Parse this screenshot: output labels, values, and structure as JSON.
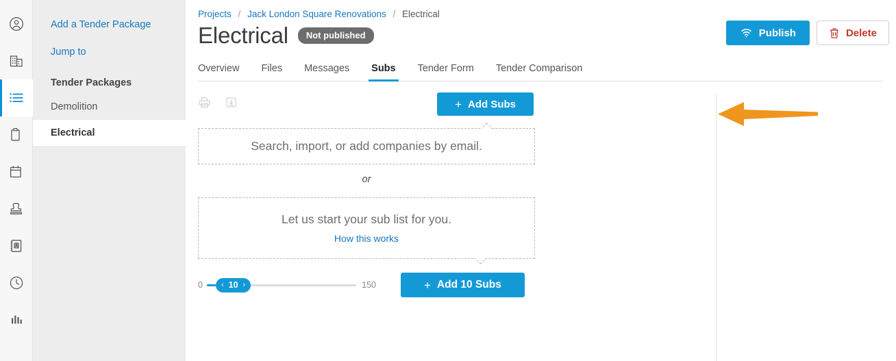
{
  "rail": {
    "items": [
      {
        "name": "account-icon",
        "label": "Account",
        "active": false
      },
      {
        "name": "company-icon",
        "label": "Company",
        "active": false
      },
      {
        "name": "list-icon",
        "label": "Projects list",
        "active": true
      },
      {
        "name": "clipboard-icon",
        "label": "Clipboard",
        "active": false
      },
      {
        "name": "calendar-icon",
        "label": "Calendar",
        "active": false
      },
      {
        "name": "stamp-icon",
        "label": "Stamp",
        "active": false
      },
      {
        "name": "contacts-icon",
        "label": "Contacts",
        "active": false
      },
      {
        "name": "clock-icon",
        "label": "History",
        "active": false
      },
      {
        "name": "chart-icon",
        "label": "Reports",
        "active": false
      }
    ]
  },
  "sidebar": {
    "add_package_label": "Add a Tender Package",
    "jump_to_label": "Jump to",
    "section_heading": "Tender Packages",
    "packages": [
      {
        "label": "Demolition",
        "selected": false
      },
      {
        "label": "Electrical",
        "selected": true
      }
    ]
  },
  "breadcrumb": {
    "projects": "Projects",
    "project": "Jack London Square Renovations",
    "current": "Electrical",
    "separator": "/"
  },
  "header": {
    "title": "Electrical",
    "status_badge": "Not published",
    "publish_label": "Publish",
    "delete_label": "Delete"
  },
  "tabs": [
    {
      "label": "Overview",
      "active": false
    },
    {
      "label": "Files",
      "active": false
    },
    {
      "label": "Messages",
      "active": false
    },
    {
      "label": "Subs",
      "active": true
    },
    {
      "label": "Tender Form",
      "active": false
    },
    {
      "label": "Tender Comparison",
      "active": false
    }
  ],
  "toolbar": {
    "print_icon": "print-icon",
    "export_icon": "export-icon",
    "add_subs_label": "Add Subs",
    "plus": "+"
  },
  "panel": {
    "search_box_text": "Search, import, or add companies by email.",
    "or_label": "or",
    "start_list_text": "Let us start your sub list for you.",
    "how_it_works_label": "How this works"
  },
  "slider": {
    "min_label": "0",
    "max_label": "150",
    "value": "10",
    "prev_chevron": "‹",
    "next_chevron": "›",
    "add_button_label": "Add 10 Subs",
    "plus": "+"
  },
  "colors": {
    "accent_blue": "#139ad6",
    "link_blue": "#1878be",
    "badge_gray": "#6d6d6d",
    "delete_red": "#c0392b",
    "annotation_orange": "#f0951e"
  }
}
